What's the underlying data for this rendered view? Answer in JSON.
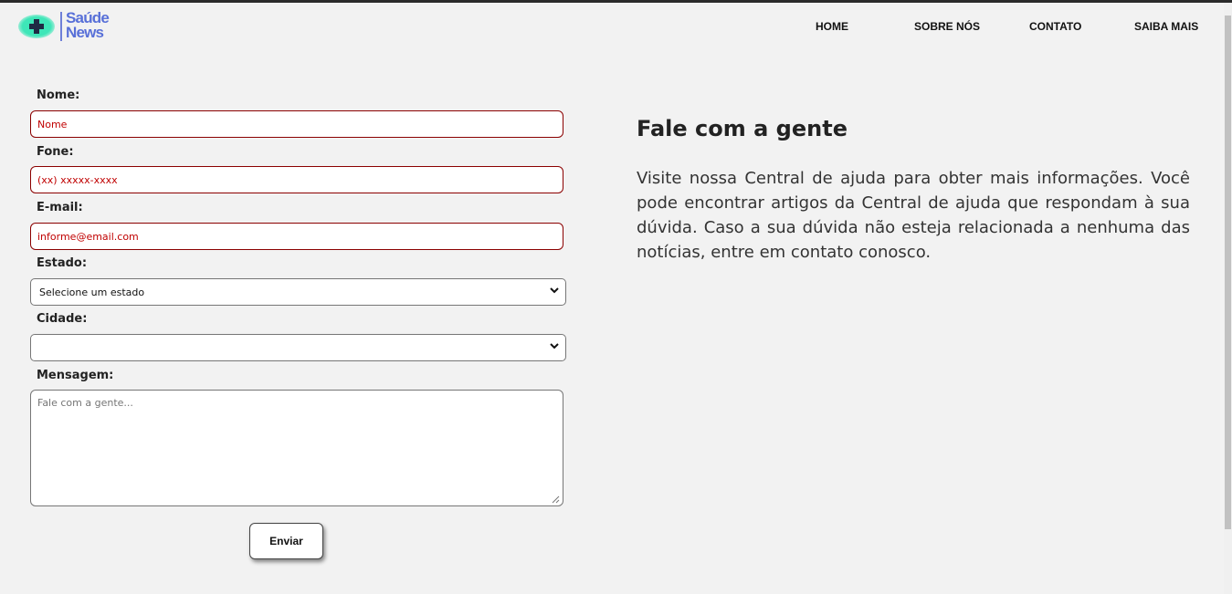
{
  "brand": {
    "logo_line1": "Saúde",
    "logo_line2": "News",
    "colors": {
      "logo_text": "#5870d8",
      "logo_eye": "#3ee6b8"
    }
  },
  "nav": {
    "items": [
      "HOME",
      "SOBRE NÓS",
      "CONTATO",
      "SAIBA MAIS"
    ]
  },
  "form": {
    "nome": {
      "label": "Nome:",
      "placeholder": "Nome"
    },
    "fone": {
      "label": "Fone:",
      "placeholder": "(xx) xxxxx-xxxx"
    },
    "email": {
      "label": "E-mail:",
      "placeholder": "informe@email.com"
    },
    "estado": {
      "label": "Estado:",
      "selected": "Selecione um estado"
    },
    "cidade": {
      "label": "Cidade:",
      "selected": ""
    },
    "mensagem": {
      "label": "Mensagem:",
      "placeholder": "Fale com a gente..."
    },
    "submit_label": "Enviar",
    "colors": {
      "input_border": "#8b0000",
      "placeholder": "#c00000"
    }
  },
  "contact": {
    "title": "Fale com a gente",
    "body": "Visite nossa Central de ajuda para obter mais informações. Você pode encontrar artigos da Central de ajuda que respondam à sua dúvida. Caso a sua dúvida não esteja relacionada a nenhuma das notícias, entre em contato conosco."
  }
}
